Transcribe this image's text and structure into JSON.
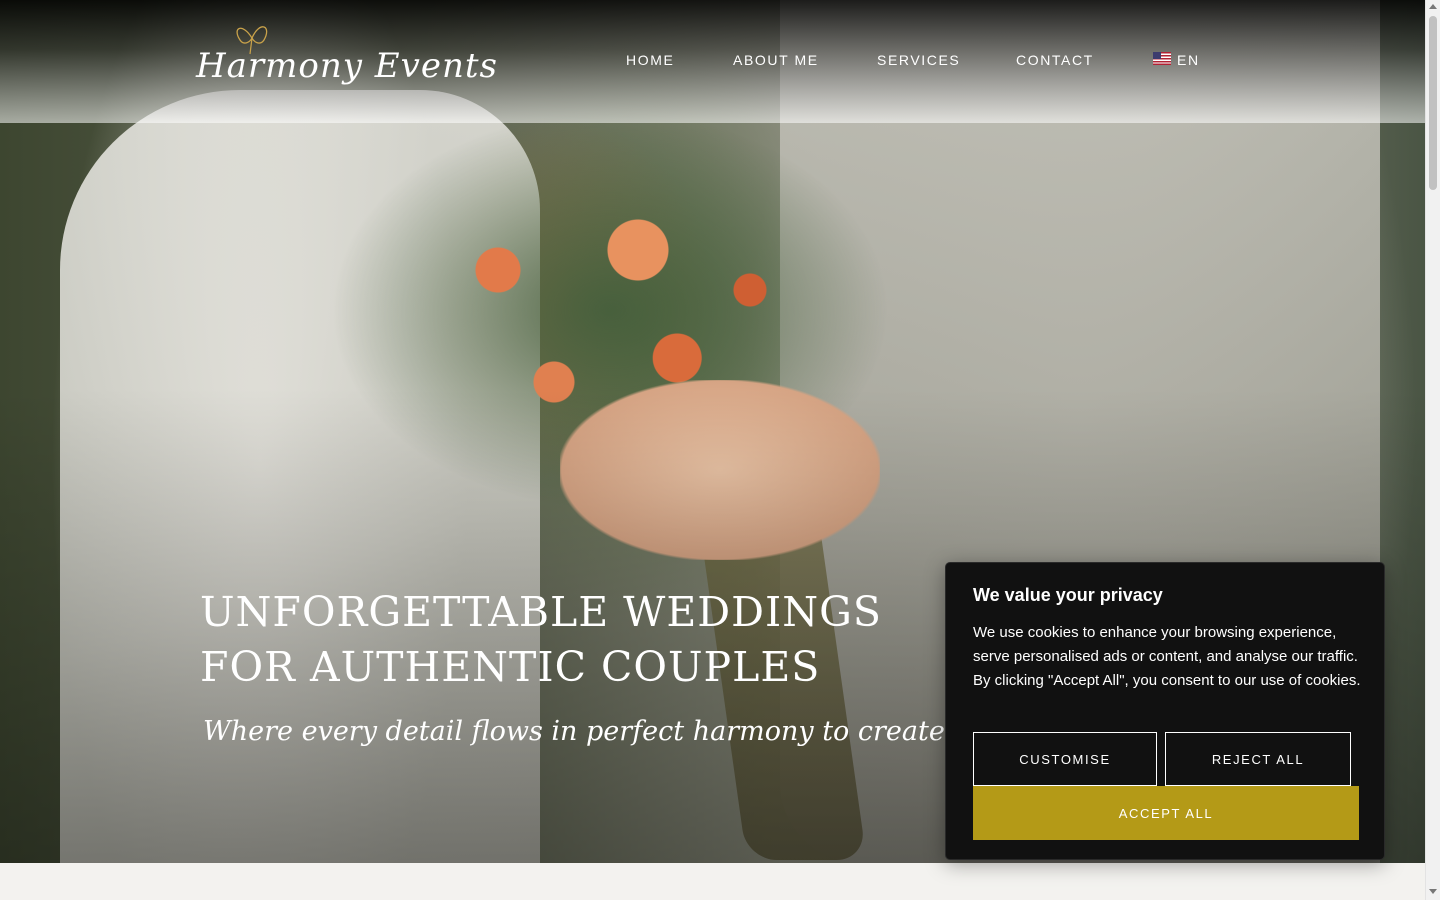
{
  "brand": {
    "logo_text": "Harmony Events"
  },
  "nav": {
    "items": [
      {
        "label": "HOME"
      },
      {
        "label": "ABOUT ME"
      },
      {
        "label": "SERVICES"
      },
      {
        "label": "CONTACT"
      }
    ],
    "language": {
      "label": "EN",
      "flag_icon": "us-flag-icon"
    }
  },
  "hero": {
    "title_line1": "UNFORGETTABLE WEDDINGS",
    "title_line2": "FOR AUTHENTIC COUPLES",
    "subtitle": "Where every detail flows in perfect harmony to create a day as uniqu"
  },
  "cookie_banner": {
    "title": "We value your privacy",
    "text": "We use cookies to enhance your browsing experience, serve personalised ads or content, and analyse our traffic. By clicking \"Accept All\", you consent to our use of cookies.",
    "customise_label": "CUSTOMISE",
    "reject_label": "REJECT ALL",
    "accept_label": "ACCEPT ALL"
  },
  "colors": {
    "accent": "#b49a17",
    "banner_bg": "#111111",
    "text_light": "#ffffff"
  }
}
